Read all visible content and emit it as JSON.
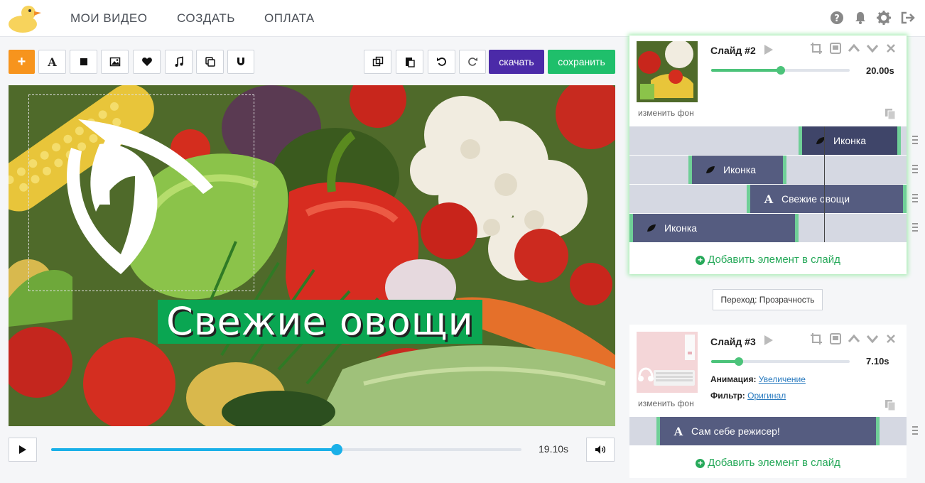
{
  "nav": {
    "items": [
      {
        "label": "МОИ ВИДЕО"
      },
      {
        "label": "СОЗДАТЬ"
      },
      {
        "label": "ОПЛАТА"
      }
    ]
  },
  "toolbar": {
    "add_label": "+",
    "text_label": "A",
    "download_label": "скачать",
    "save_label": "сохранить"
  },
  "canvas": {
    "caption": "Свежие овощи"
  },
  "player": {
    "time": "19.10s",
    "progress": 0.607
  },
  "slides": [
    {
      "title": "Слайд #2",
      "change_bg": "изменить фон",
      "duration": "20.00s",
      "progress": 0.5,
      "tracks": [
        {
          "label": "Иконка",
          "icon": "leaf-icon"
        },
        {
          "label": "Иконка",
          "icon": "leaf-icon"
        },
        {
          "label": "Свежие овощи",
          "icon": "text-icon"
        },
        {
          "label": "Иконка",
          "icon": "leaf-icon"
        }
      ],
      "add_element": "Добавить элемент в слайд"
    },
    {
      "title": "Слайд #3",
      "change_bg": "изменить фон",
      "duration": "7.10s",
      "progress": 0.2,
      "animation_label": "Анимация:",
      "animation_value": "Увеличение",
      "filter_label": "Фильтр:",
      "filter_value": "Оригинал",
      "tracks": [
        {
          "label": "Сам себе режисер!",
          "icon": "text-icon"
        }
      ],
      "add_element": "Добавить элемент в слайд"
    }
  ],
  "transition": {
    "label": "Переход: Прозрачность"
  },
  "colors": {
    "accent_orange": "#f7941d",
    "download_purple": "#4b2aa8",
    "save_green": "#1fbf6b",
    "player_blue": "#1ab0e8",
    "caption_green": "#0aa652"
  }
}
